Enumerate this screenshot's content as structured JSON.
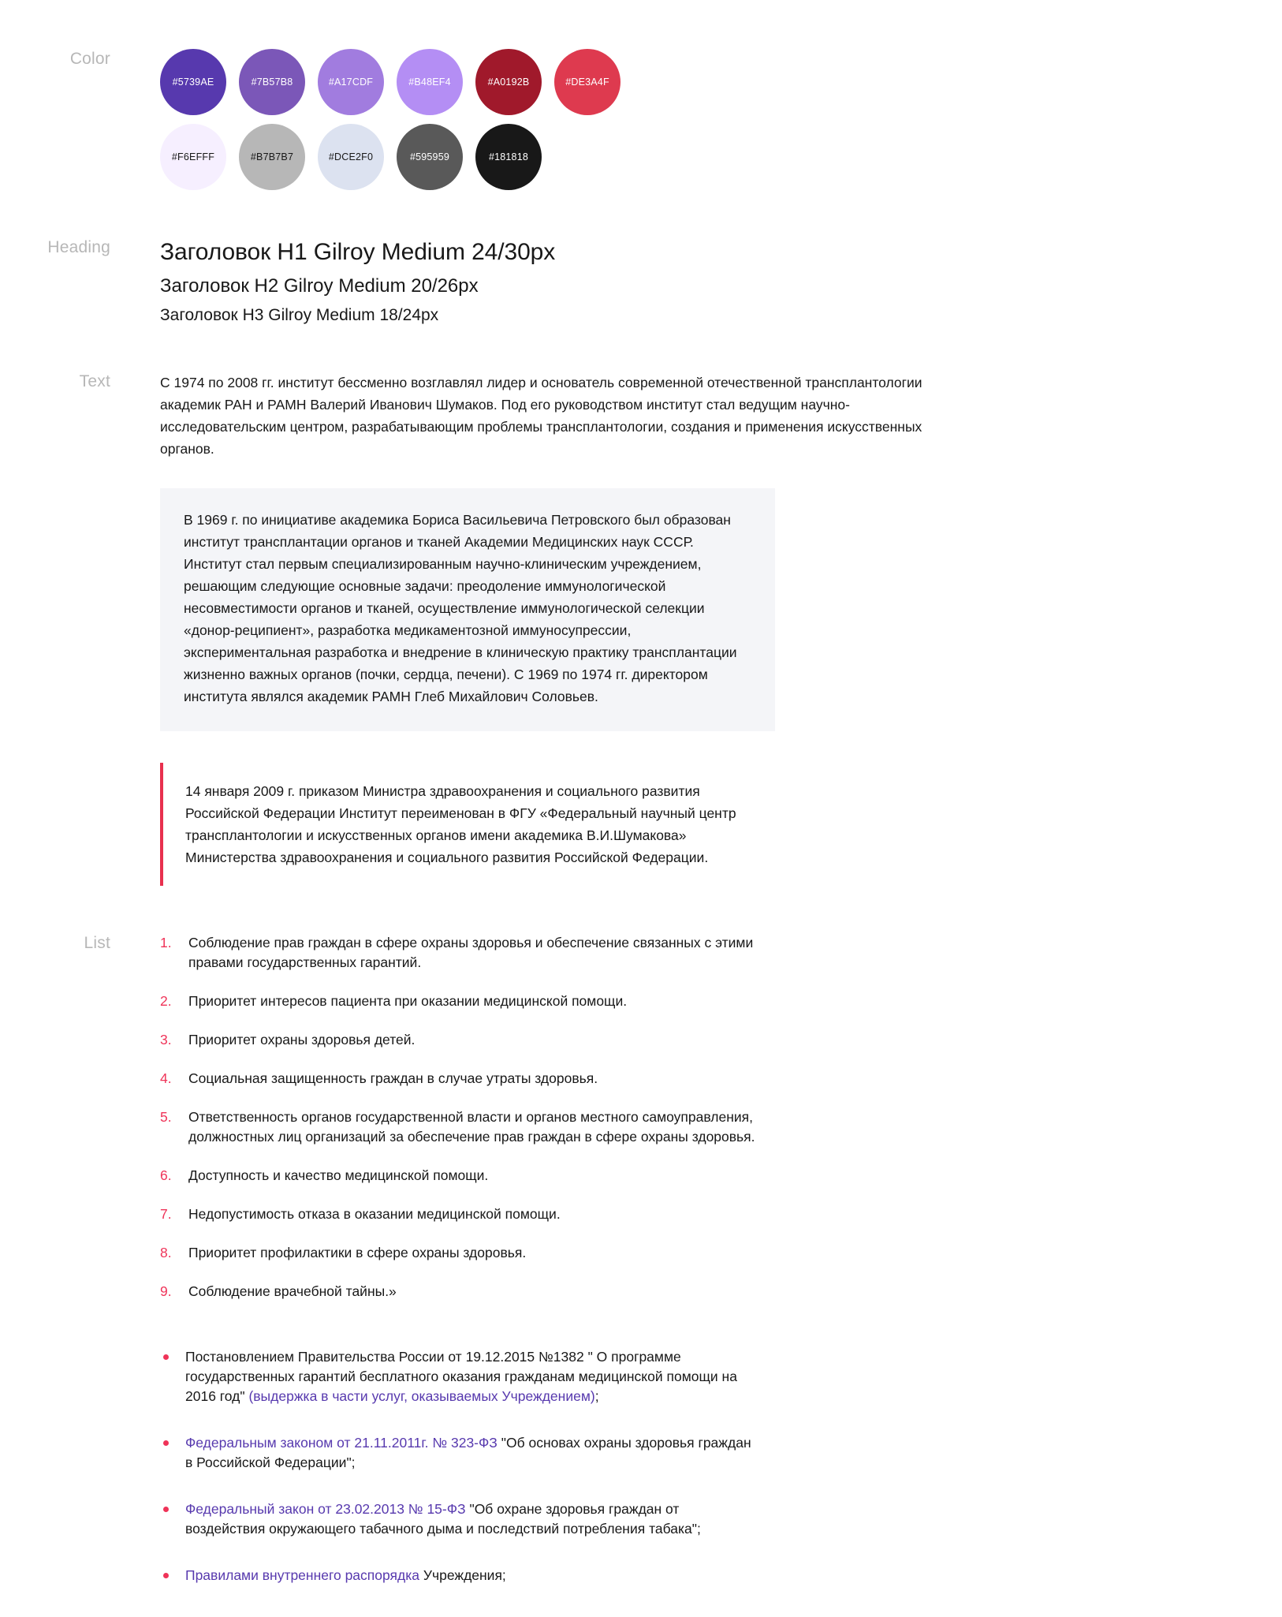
{
  "sections": {
    "color_label": "Color",
    "heading_label": "Heading",
    "text_label": "Text",
    "list_label": "List"
  },
  "colors": {
    "row1": [
      {
        "hex": "#5739AE",
        "label": "#5739AE",
        "text_color": "#FFFFFF"
      },
      {
        "hex": "#7B57B8",
        "label": "#7B57B8",
        "text_color": "#FFFFFF"
      },
      {
        "hex": "#A17CDF",
        "label": "#A17CDF",
        "text_color": "#FFFFFF"
      },
      {
        "hex": "#B48EF4",
        "label": "#B48EF4",
        "text_color": "#FFFFFF"
      },
      {
        "hex": "#A0192B",
        "label": "#A0192B",
        "text_color": "#FFFFFF"
      },
      {
        "hex": "#DE3A4F",
        "label": "#DE3A4F",
        "text_color": "#FFFFFF"
      }
    ],
    "row2": [
      {
        "hex": "#F6EFFF",
        "label": "#F6EFFF",
        "text_color": "#181818"
      },
      {
        "hex": "#B7B7B7",
        "label": "#B7B7B7",
        "text_color": "#181818"
      },
      {
        "hex": "#DCE2F0",
        "label": "#DCE2F0",
        "text_color": "#181818"
      },
      {
        "hex": "#595959",
        "label": "#595959",
        "text_color": "#FFFFFF"
      },
      {
        "hex": "#181818",
        "label": "#181818",
        "text_color": "#FFFFFF"
      }
    ]
  },
  "headings": {
    "h1": "Заголовок H1 Gilroy Medium 24/30px",
    "h2": "Заголовок H2 Gilroy Medium 20/26px",
    "h3": "Заголовок H3 Gilroy Medium 18/24px"
  },
  "text": {
    "paragraph": "С 1974 по 2008 гг. институт бессменно возглавлял лидер и основатель современной отечественной трансплантологии академик РАН и РАМН Валерий Иванович Шумаков. Под его руководством институт стал ведущим научно-исследовательским центром, разрабатывающим проблемы трансплантологии, создания и применения искусственных органов.",
    "gray_box": "В 1969 г. по инициативе академика Бориса Васильевича Петровского был образован институт трансплантации органов и тканей Академии Медицинских наук СССР. Институт стал первым специализированным научно-клиническим учреждением, решающим следующие основные задачи: преодоление иммунологической несовместимости органов и тканей, осуществление иммунологической селекции «донор-реципиент», разработка медикаментозной иммуносупрессии, экспериментальная разработка и внедрение в клиническую практику трансплантации жизненно важных органов (почки, сердца, печени). С 1969 по 1974 гг. директором института являлся академик РАМН Глеб Михайлович Соловьев.",
    "quote": "14 января 2009 г. приказом Министра здравоохранения и социального развития Российской Федерации Институт переименован в ФГУ «Федеральный научный центр трансплантологии и искусственных органов имени академика В.И.Шумакова» Министерства здравоохранения и социального развития Российской Федерации."
  },
  "numbered_list": [
    {
      "marker": "1.",
      "text": "Соблюдение прав граждан в сфере охраны здоровья и обеспечение связанных с этими правами государственных гарантий."
    },
    {
      "marker": "2.",
      "text": "Приоритет интересов пациента при оказании медицинской помощи."
    },
    {
      "marker": "3.",
      "text": "Приоритет охраны здоровья детей."
    },
    {
      "marker": "4.",
      "text": "Социальная защищенность граждан в случае утраты здоровья."
    },
    {
      "marker": "5.",
      "text": "Ответственность органов государственной власти и органов местного самоуправления, должностных лиц организаций за обеспечение прав граждан в сфере охраны здоровья."
    },
    {
      "marker": "6.",
      "text": "Доступность и качество медицинской помощи."
    },
    {
      "marker": "7.",
      "text": "Недопустимость отказа в оказании медицинской помощи."
    },
    {
      "marker": "8.",
      "text": "Приоритет профилактики в сфере охраны здоровья."
    },
    {
      "marker": "9.",
      "text": "Соблюдение врачебной тайны.»"
    }
  ],
  "bullet_list": [
    {
      "plain_before": "Постановлением Правительства России от 19.12.2015 №1382 \" О программе государственных гарантий бесплатного оказания гражданам медицинской помощи на 2016 год\" ",
      "link": "(выдержка в части услуг, оказываемых Учреждением)",
      "plain_after": ";"
    },
    {
      "plain_before": "",
      "link": "Федеральным законом от 21.11.2011г. № 323-ФЗ",
      "plain_after": " \"Об основах охраны здоровья граждан в Российской Федерации\";"
    },
    {
      "plain_before": "",
      "link": "Федеральный закон от 23.02.2013 № 15-ФЗ",
      "plain_after": " \"Об охране здоровья граждан от воздействия окружающего табачного дыма и последствий потребления табака\";"
    },
    {
      "plain_before": "",
      "link": "Правилами внутреннего распорядка",
      "plain_after": " Учреждения;"
    }
  ],
  "accents": {
    "link_color": "#5739AE",
    "marker_color": "#EF3358",
    "quote_border_color": "#E8304E",
    "gray_box_bg": "#F4F5F8",
    "label_color": "#B7B7B7"
  }
}
